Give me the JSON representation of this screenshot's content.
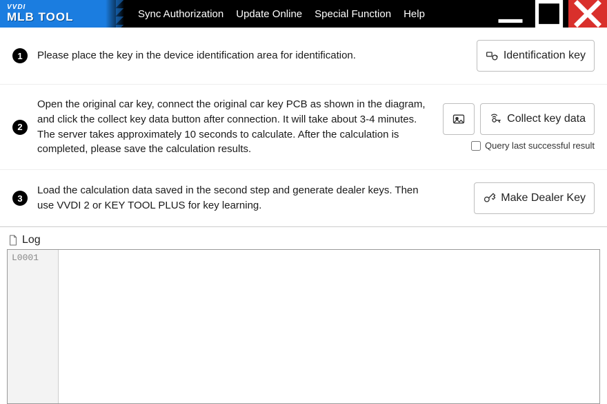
{
  "logo": {
    "top": "VVDI",
    "bottom": "MLB TOOL"
  },
  "menu": {
    "sync": "Sync Authorization",
    "update": "Update Online",
    "special": "Special Function",
    "help": "Help"
  },
  "steps": {
    "s1": {
      "num": "1",
      "text": "Please place the key in the device identification area for identification.",
      "button": "Identification key"
    },
    "s2": {
      "num": "2",
      "text": "Open the original car key, connect the original car key PCB as shown in the diagram, and click the collect key data button after connection. It will take about 3-4 minutes. The server takes approximately 10 seconds to calculate. After the calculation is completed, please save the calculation results.",
      "button": "Collect key data",
      "checkbox": "Query last successful result"
    },
    "s3": {
      "num": "3",
      "text": "Load the calculation data saved in the second step and generate dealer keys. Then use VVDI 2 or KEY TOOL PLUS for key learning.",
      "button": "Make Dealer Key"
    }
  },
  "log": {
    "title": "Log",
    "line1": "L0001"
  }
}
